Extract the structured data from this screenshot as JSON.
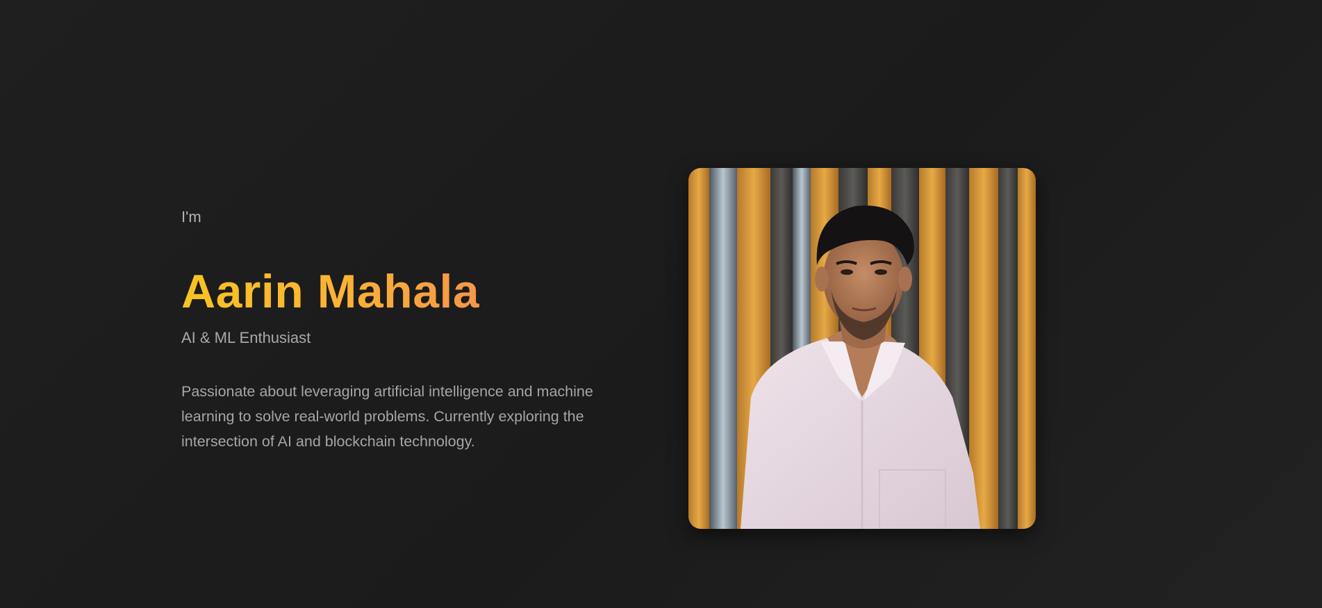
{
  "hero": {
    "intro": "I'm",
    "name": "Aarin Mahala",
    "role": "AI & ML Enthusiast",
    "bio": "Passionate about leveraging artificial intelligence and machine learning to solve real-world problems. Currently exploring the intersection of AI and blockchain technology."
  },
  "colors": {
    "background": "#1e1e1e",
    "name_gradient_start": "#f8c322",
    "name_gradient_end": "#f4964a",
    "text_muted": "#a9a9a9"
  }
}
